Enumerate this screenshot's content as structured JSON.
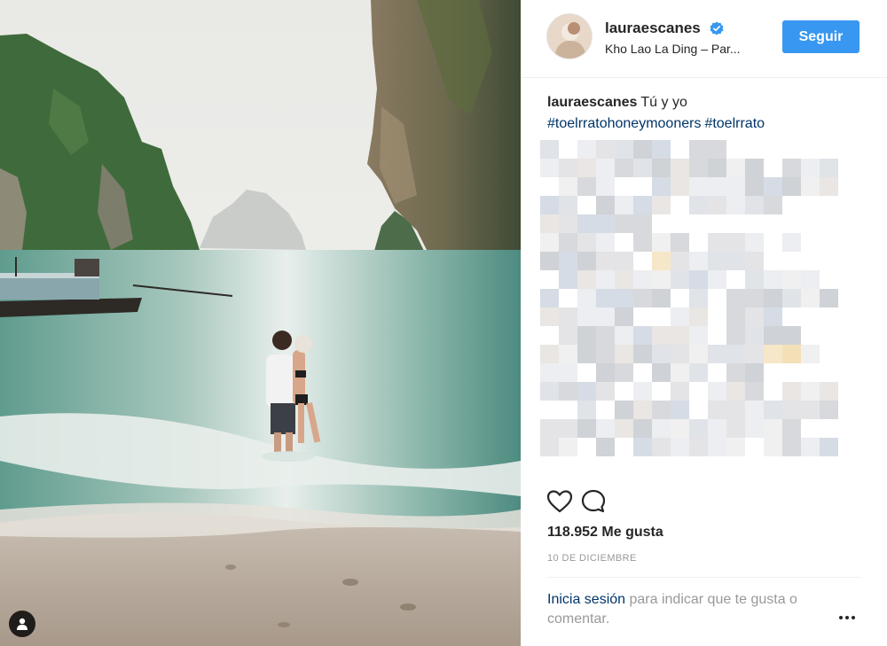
{
  "post": {
    "photo_alt": "laura escanes beach photo",
    "tag_icon": "user-tag-icon"
  },
  "header": {
    "username": "lauraescanes",
    "verified_icon": "verified-badge-icon",
    "location": "Kho Lao La Ding – Par...",
    "follow_label": "Seguir"
  },
  "caption": {
    "username": "lauraescanes",
    "text": "Tú y yo",
    "hashtags": [
      "#toelrratohoneymooners",
      "#toelrrato"
    ]
  },
  "actions": {
    "like_icon": "heart-icon",
    "comment_icon": "comment-icon"
  },
  "likes": "118.952 Me gusta",
  "date": "10 DE DICIEMBRE",
  "login": {
    "link": "Inicia sesión",
    "rest": " para indicar que te gusta o comentar."
  },
  "more_icon": "more-options-icon",
  "colors": {
    "follow_button": "#3897f0",
    "hashtag": "#003569",
    "muted": "#999999"
  }
}
